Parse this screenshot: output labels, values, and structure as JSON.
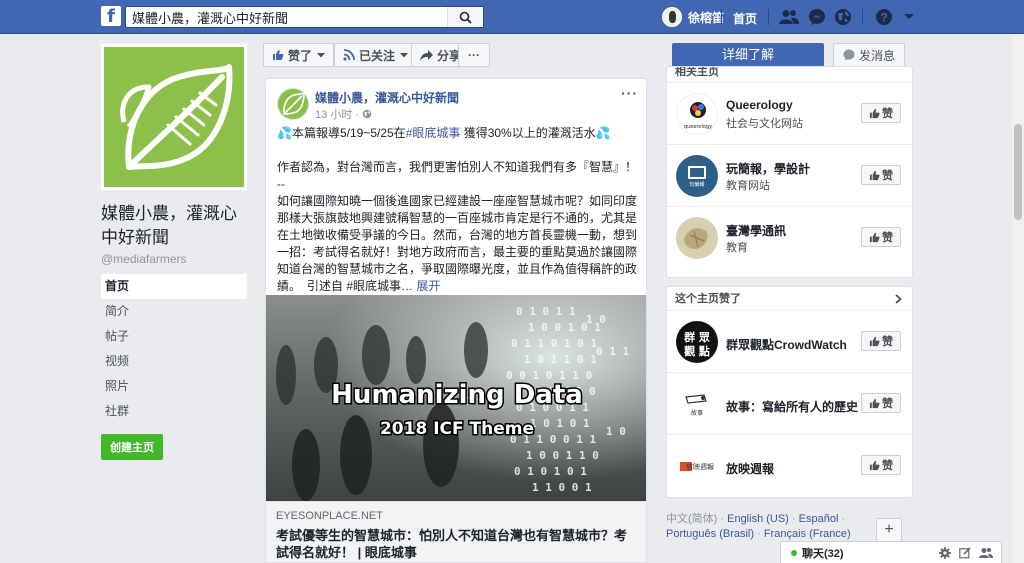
{
  "topbar": {
    "logo": "f",
    "search_value": "媒體小農，灌溉心中好新聞",
    "user_name": "徐榕笛",
    "home_label": "首页"
  },
  "page": {
    "name": "媒體小農，灌溉心中好新聞",
    "handle": "@mediafarmers",
    "nav": [
      "首页",
      "简介",
      "帖子",
      "视频",
      "照片",
      "社群"
    ],
    "create_label": "创建主页"
  },
  "actions": {
    "like_label": "赞了",
    "follow_label": "已关注",
    "share_label": "分享",
    "more_label": "···",
    "learn_more_label": "详细了解",
    "message_label": "发消息"
  },
  "post": {
    "author": "媒體小農，灌溉心中好新聞",
    "time": "13 小时 ·",
    "more": "···",
    "line1_prefix": "本篇報導5/19~5/25在",
    "line1_hash": "#眼底城事",
    "line1_suffix": " 獲得30%以上的灌溉活水",
    "para2": "作者認為，對台灣而言，我們更害怕別人不知道我們有多『智慧』！",
    "dash": "--",
    "para3": "如何讓國際知曉一個後進國家已經建設一座座智慧城市呢？如同印度那樣大張旗鼓地興建號稱智慧的一百座城市肯定是行不通的，尤其是在土地徵收備受爭議的今日。然而，台灣的地方首長靈機一動，想到一招：考試得名就好！對地方政府而言，最主要的重點莫過於讓國際知道台灣的智慧城市之名，爭取國際曝光度，並且作為值得稱許的政績。　引述自 #眼底城事…",
    "expand": "展开",
    "image_title": "Humanizing Data",
    "image_subtitle": "2018 ICF Theme",
    "link_domain": "EYESONPLACE.NET",
    "link_title": "考試優等生的智慧城市：怕別人不知道台灣也有智慧城市？考試得名就好！ | 眼底城事"
  },
  "liked_pages_header": "相关主页",
  "liked_pages": [
    {
      "name": "Queerology",
      "category": "社会与文化网站",
      "like": "赞",
      "avatar_text": "queerology"
    },
    {
      "name": "玩簡報，學設計",
      "category": "教育网站",
      "like": "赞",
      "avatar_text": "玩簡報"
    },
    {
      "name": "臺灣學通訊",
      "category": "教育",
      "like": "赞",
      "avatar_text": ""
    }
  ],
  "page_likes_header": "这个主页赞了",
  "page_likes": [
    {
      "name": "群眾觀點CrowdWatch",
      "like": "赞",
      "avatar_text": "群眾觀點"
    },
    {
      "name": "故事：寫給所有人的歷史",
      "like": "赞",
      "avatar_text": "故事"
    },
    {
      "name": "放映週報",
      "like": "赞",
      "avatar_text": "放映週報"
    }
  ],
  "languages": {
    "line1_a": "中文(简体)",
    "line1_b": "English (US)",
    "line1_c": "Español",
    "line2_a": "Português (Brasil)",
    "line2_b": "Français (France)",
    "plus": "+"
  },
  "chat": {
    "label": "聊天(32)"
  },
  "colors": {
    "brand": "#4267b2",
    "page_green": "#8cc04a",
    "link": "#385898",
    "create_green": "#42b72a"
  }
}
